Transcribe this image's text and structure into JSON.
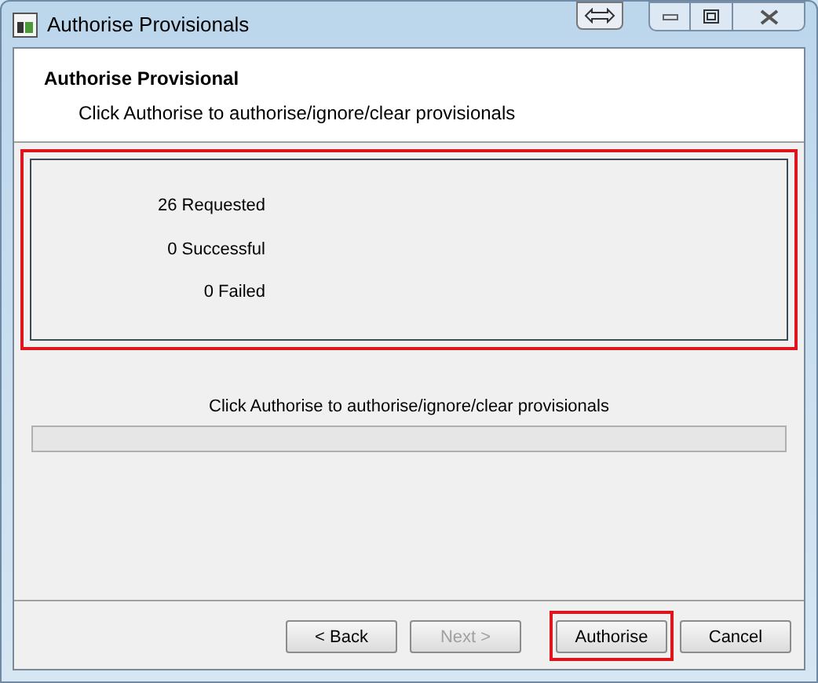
{
  "window": {
    "title": "Authorise Provisionals"
  },
  "header": {
    "title": "Authorise Provisional",
    "subtitle": "Click Authorise to authorise/ignore/clear provisionals"
  },
  "summary": {
    "highlighted": true,
    "lines": [
      "26 Requested",
      "0 Successful",
      "0 Failed"
    ]
  },
  "progress": {
    "label": "Click Authorise to authorise/ignore/clear provisionals",
    "level": 0
  },
  "buttons": [
    {
      "label": "< Back",
      "disabled": false,
      "highlighted": false
    },
    {
      "label": "Next >",
      "disabled": true,
      "highlighted": false
    },
    {
      "label": "Authorise",
      "disabled": false,
      "highlighted": true
    },
    {
      "label": "Cancel",
      "disabled": false,
      "highlighted": false
    }
  ]
}
